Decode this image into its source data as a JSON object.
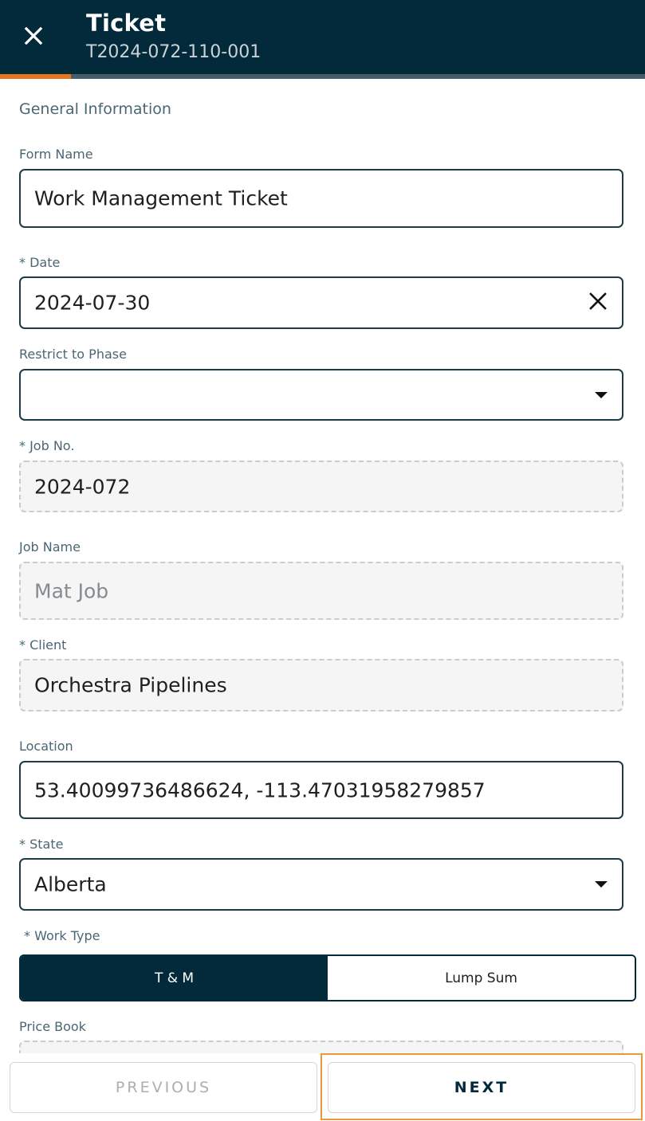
{
  "header": {
    "title": "Ticket",
    "subtitle": "T2024-072-110-001",
    "close_icon": "close-icon",
    "progress": 0.11,
    "progress_color": "#e5751f",
    "background_color": "#022a3a"
  },
  "section": {
    "title": "General Information"
  },
  "form": {
    "form_name": {
      "label": "Form Name",
      "value": "Work Management Ticket"
    },
    "date": {
      "label": "* Date",
      "value": "2024-07-30",
      "clear_icon": "clear-icon"
    },
    "restrict_to_phase": {
      "label": "Restrict to Phase",
      "value": "",
      "dropdown_icon": "chevron-down-icon"
    },
    "job_no": {
      "label": "* Job No.",
      "value": "2024-072"
    },
    "job_name": {
      "label": "Job Name",
      "value": "Mat Job"
    },
    "client": {
      "label": "* Client",
      "value": "Orchestra Pipelines"
    },
    "location": {
      "label": "Location",
      "value": "53.40099736486624, -113.47031958279857"
    },
    "state": {
      "label": "* State",
      "value": "Alberta",
      "dropdown_icon": "chevron-down-icon"
    },
    "work_type": {
      "label": "* Work Type",
      "options": [
        "T & M",
        "Lump Sum"
      ],
      "selected": "T & M"
    },
    "price_book": {
      "label": "Price Book"
    }
  },
  "footer": {
    "previous_label": "PREVIOUS",
    "next_label": "NEXT",
    "highlight_color": "#e69a3c"
  }
}
